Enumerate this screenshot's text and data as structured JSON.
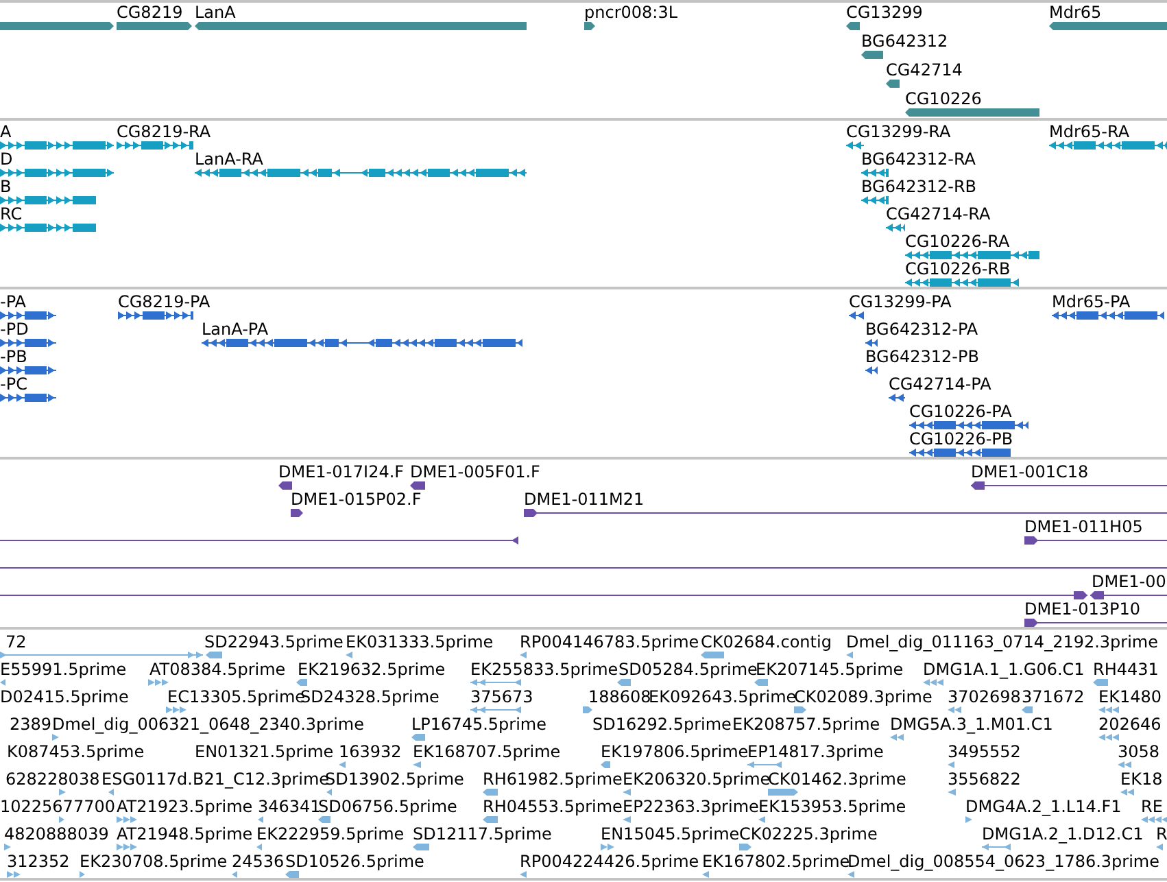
{
  "tracks": [
    {
      "kind": "genes",
      "features": [
        {
          "reverse": false
        },
        {
          "label": "CG8219",
          "reverse": false
        },
        {
          "label": "LanA",
          "reverse": true
        },
        {
          "label": "pncr008:3L",
          "reverse": false
        },
        {
          "label": "CG13299",
          "reverse": true
        },
        {
          "label": "Mdr65",
          "reverse": true
        },
        {
          "label": "BG642312",
          "reverse": true
        },
        {
          "label": "CG42714",
          "reverse": true
        },
        {
          "label": "CG10226",
          "reverse": true
        }
      ]
    },
    {
      "kind": "transcripts",
      "features": [
        {
          "label": "A",
          "reverse": false
        },
        {
          "label": "CG8219-RA",
          "reverse": false
        },
        {
          "label": "CG13299-RA",
          "reverse": true
        },
        {
          "label": "Mdr65-RA",
          "reverse": true
        },
        {
          "label": "D",
          "reverse": false
        },
        {
          "label": "LanA-RA",
          "reverse": true
        },
        {
          "label": "BG642312-RA",
          "reverse": true
        },
        {
          "label": "B",
          "reverse": false
        },
        {
          "label": "BG642312-RB",
          "reverse": true
        },
        {
          "label": "RC",
          "reverse": false
        },
        {
          "label": "CG42714-RA",
          "reverse": true
        },
        {
          "label": "CG10226-RA",
          "reverse": true
        },
        {
          "label": "CG10226-RB",
          "reverse": true
        }
      ]
    },
    {
      "kind": "proteins",
      "features": [
        {
          "label": "-PA",
          "reverse": false
        },
        {
          "label": "CG8219-PA",
          "reverse": false
        },
        {
          "label": "CG13299-PA",
          "reverse": true
        },
        {
          "label": "Mdr65-PA",
          "reverse": true
        },
        {
          "label": "-PD",
          "reverse": false
        },
        {
          "label": "LanA-PA",
          "reverse": true
        },
        {
          "label": "BG642312-PA",
          "reverse": true
        },
        {
          "label": "-PB",
          "reverse": false
        },
        {
          "label": "BG642312-PB",
          "reverse": true
        },
        {
          "label": "-PC",
          "reverse": false
        },
        {
          "label": "CG42714-PA",
          "reverse": true
        },
        {
          "label": "CG10226-PA",
          "reverse": true
        },
        {
          "label": "CG10226-PB",
          "reverse": true
        }
      ]
    },
    {
      "kind": "clones",
      "features": [
        {
          "kind": "end",
          "label": "DME1-017I24.F",
          "reverse": true
        },
        {
          "kind": "end",
          "label": "DME1-005F01.F",
          "reverse": true
        },
        {
          "kind": "clone",
          "label": "DME1-001C18",
          "reverse": true
        },
        {
          "kind": "end",
          "label": "DME1-015P02.F",
          "reverse": false
        },
        {
          "kind": "clone",
          "label": "DME1-011M21",
          "reverse": false
        },
        {
          "kind": "clone",
          "reverse": true
        },
        {
          "kind": "clone",
          "label": "DME1-011H05",
          "reverse": false
        },
        {
          "kind": "clone"
        },
        {
          "kind": "clone",
          "reverse": false
        },
        {
          "kind": "clone",
          "label": "DME1-00",
          "reverse": true
        },
        {
          "kind": "clone",
          "label": "DME1-013P10",
          "reverse": false
        }
      ]
    },
    {
      "kind": "ests",
      "features": [
        {
          "label": "72",
          "reverse": false
        },
        {
          "label": "SD22943.5prime",
          "reverse": true
        },
        {
          "label": "EK031333.5prime",
          "reverse": true
        },
        {
          "label": "RP004146783.5prime",
          "reverse": true
        },
        {
          "label": "CK02684.contig",
          "reverse": true
        },
        {
          "label": "Dmel_dig_011163_0714_2192.3prime",
          "reverse": true
        },
        {
          "label": "E55991.5prime",
          "reverse": true
        },
        {
          "label": "AT08384.5prime",
          "reverse": false
        },
        {
          "label": "EK219632.5prime",
          "reverse": true
        },
        {
          "label": "EK255833.5prime",
          "reverse": true
        },
        {
          "label": "SD05284.5prime",
          "reverse": true
        },
        {
          "label": "EK207145.5prime",
          "reverse": true
        },
        {
          "label": "DMG1A.1_1.G06.C1",
          "reverse": true
        },
        {
          "label": "RH4431",
          "reverse": true
        },
        {
          "label": "D02415.5prime"
        },
        {
          "label": "EC13305.5prime",
          "reverse": false
        },
        {
          "label": "SD24328.5prime"
        },
        {
          "label": "375673",
          "reverse": true
        },
        {
          "label": "188608",
          "reverse": false
        },
        {
          "label": "EK092643.5prime"
        },
        {
          "label": "CK02089.3prime",
          "reverse": false
        },
        {
          "label": "3702698",
          "reverse": true
        },
        {
          "label": "371672",
          "reverse": true
        },
        {
          "label": "EK1480",
          "reverse": true
        },
        {
          "label": "2389"
        },
        {
          "label": "Dmel_dig_006321_0648_2340.3prime",
          "reverse": false
        },
        {
          "label": "LP16745.5prime",
          "reverse": true
        },
        {
          "label": "SD16292.5prime"
        },
        {
          "label": "EK208757.5prime"
        },
        {
          "label": "DMG5A.3_1.M01.C1",
          "reverse": true
        },
        {
          "label": "202646",
          "reverse": true
        },
        {
          "label": "K087453.5prime"
        },
        {
          "label": "EN01321.5prime"
        },
        {
          "label": "163932",
          "reverse": true
        },
        {
          "label": "EK168707.5prime",
          "reverse": true
        },
        {
          "label": "EK197806.5prime",
          "reverse": true
        },
        {
          "label": "EP14817.3prime",
          "reverse": true
        },
        {
          "label": "3495552",
          "reverse": true
        },
        {
          "label": "3058",
          "reverse": true
        },
        {
          "label": "628228038",
          "reverse": false
        },
        {
          "label": "ESG0117d.B21_C12.3prime",
          "reverse": true
        },
        {
          "label": "SD13902.5prime",
          "reverse": true
        },
        {
          "label": "RH61982.5prime",
          "reverse": true
        },
        {
          "label": "EK206320.5prime",
          "reverse": true
        },
        {
          "label": "CK01462.3prime",
          "reverse": false
        },
        {
          "label": "3556822",
          "reverse": true
        },
        {
          "label": "EK18",
          "reverse": true
        },
        {
          "label": "10225677700",
          "reverse": false
        },
        {
          "label": "AT21923.5prime",
          "reverse": false
        },
        {
          "label": "346341",
          "reverse": true
        },
        {
          "label": "SD06756.5prime",
          "reverse": true
        },
        {
          "label": "RH04553.5prime",
          "reverse": true
        },
        {
          "label": "EP22363.3prime",
          "reverse": true
        },
        {
          "label": "EK153953.5prime",
          "reverse": true
        },
        {
          "label": "DMG4A.2_1.L14.F1",
          "reverse": false
        },
        {
          "label": "RE",
          "reverse": true
        },
        {
          "label": "4820888039",
          "reverse": false
        },
        {
          "label": "AT21948.5prime",
          "reverse": false
        },
        {
          "label": "EK222959.5prime",
          "reverse": true
        },
        {
          "label": "SD12117.5prime",
          "reverse": true
        },
        {
          "label": "EN15045.5prime",
          "reverse": false
        },
        {
          "label": "CK02225.3prime",
          "reverse": false
        },
        {
          "label": "DMG1A.2_1.D12.C1",
          "reverse": true
        },
        {
          "label": "R",
          "reverse": true
        },
        {
          "label": "312352",
          "reverse": false
        },
        {
          "label": "EK230708.5prime",
          "reverse": false
        },
        {
          "label": "24536",
          "reverse": true
        },
        {
          "label": "SD10526.5prime",
          "reverse": true
        },
        {
          "label": "RP004224426.5prime",
          "reverse": true
        },
        {
          "label": "EK167802.5prime",
          "reverse": true
        },
        {
          "label": "Dmel_dig_008554_0623_1786.3prime",
          "reverse": true
        }
      ]
    }
  ]
}
